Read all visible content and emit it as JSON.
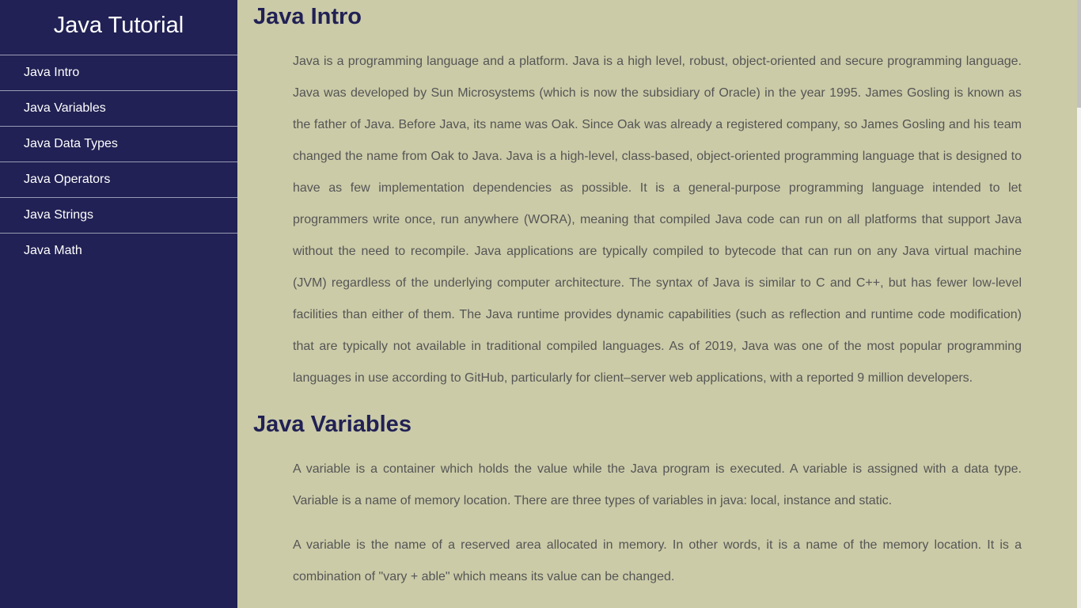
{
  "sidebar": {
    "title": "Java Tutorial",
    "items": [
      {
        "label": "Java Intro"
      },
      {
        "label": "Java Variables"
      },
      {
        "label": "Java Data Types"
      },
      {
        "label": "Java Operators"
      },
      {
        "label": "Java Strings"
      },
      {
        "label": "Java Math"
      }
    ]
  },
  "main": {
    "sections": [
      {
        "title": "Java Intro",
        "paragraphs": [
          "Java is a programming language and a platform. Java is a high level, robust, object-oriented and secure programming language. Java was developed by Sun Microsystems (which is now the subsidiary of Oracle) in the year 1995. James Gosling is known as the father of Java. Before Java, its name was Oak. Since Oak was already a registered company, so James Gosling and his team changed the name from Oak to Java. Java is a high-level, class-based, object-oriented programming language that is designed to have as few implementation dependencies as possible. It is a general-purpose programming language intended to let programmers write once, run anywhere (WORA), meaning that compiled Java code can run on all platforms that support Java without the need to recompile. Java applications are typically compiled to bytecode that can run on any Java virtual machine (JVM) regardless of the underlying computer architecture. The syntax of Java is similar to C and C++, but has fewer low-level facilities than either of them. The Java runtime provides dynamic capabilities (such as reflection and runtime code modification) that are typically not available in traditional compiled languages. As of 2019, Java was one of the most popular programming languages in use according to GitHub, particularly for client–server web applications, with a reported 9 million developers."
        ]
      },
      {
        "title": "Java Variables",
        "paragraphs": [
          "A variable is a container which holds the value while the Java program is executed. A variable is assigned with a data type. Variable is a name of memory location. There are three types of variables in java: local, instance and static.",
          "A variable is the name of a reserved area allocated in memory. In other words, it is a name of the memory location. It is a combination of \"vary + able\" which means its value can be changed."
        ]
      }
    ]
  },
  "colors": {
    "sidebar_bg": "#212155",
    "main_bg": "#cbcba8",
    "heading": "#212155",
    "body_text": "#555555"
  }
}
